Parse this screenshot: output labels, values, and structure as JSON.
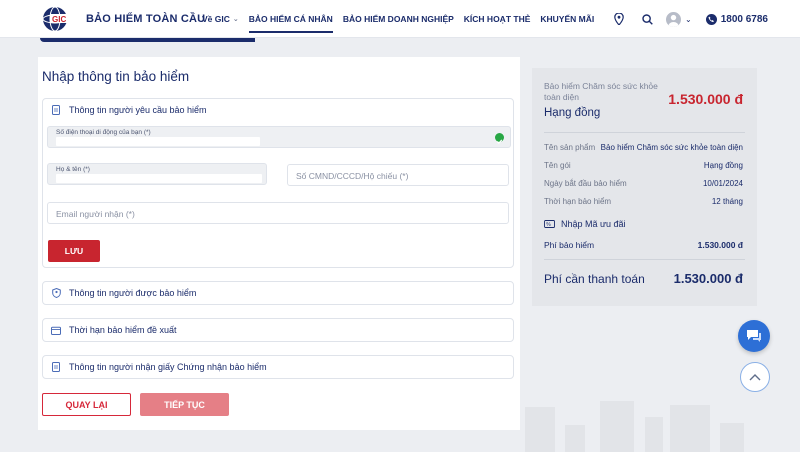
{
  "header": {
    "logo_text": "BẢO HIỂM TOÀN CẦU",
    "logo_abbr": "GIC",
    "nav": [
      {
        "label": "Về GIC",
        "dropdown": true
      },
      {
        "label": "BẢO HIỂM CÁ NHÂN",
        "active": true
      },
      {
        "label": "BẢO HIỂM DOANH NGHIỆP"
      },
      {
        "label": "KÍCH HOẠT THẺ"
      },
      {
        "label": "KHUYẾN MÃI"
      }
    ],
    "phone": "1800 6786",
    "icons": [
      "location-icon",
      "search-icon",
      "avatar",
      "chevron-down-icon",
      "phone-icon"
    ]
  },
  "form": {
    "title": "Nhập thông tin bảo hiểm",
    "requester": {
      "heading": "Thông tin người yêu cầu bảo hiểm",
      "phone_label": "Số điện thoại di động của bạn (*)",
      "name_label": "Họ & tên (*)",
      "id_placeholder": "Số CMND/CCCD/Hộ chiếu (*)",
      "email_placeholder": "Email người nhận (*)",
      "save_label": "LƯU"
    },
    "sections": [
      {
        "label": "Thông tin người được bảo hiểm",
        "icon": "shield-person-icon"
      },
      {
        "label": "Thời hạn bảo hiểm đề xuất",
        "icon": "calendar-icon"
      },
      {
        "label": "Thông tin người nhận giấy Chứng nhận bảo hiểm",
        "icon": "document-icon"
      }
    ],
    "back_label": "QUAY LẠI",
    "next_label": "TIẾP TỤC"
  },
  "summary": {
    "product_name": "Bảo hiểm Chăm sóc sức khỏe toàn diện",
    "plan": "Hạng đồng",
    "price": "1.530.000 đ",
    "rows": [
      {
        "label": "Tên sản phẩm",
        "value": "Bảo hiểm Chăm sóc sức khỏe toàn diện"
      },
      {
        "label": "Tên gói",
        "value": "Hạng đồng"
      },
      {
        "label": "Ngày bắt đầu bảo hiểm",
        "value": "10/01/2024"
      },
      {
        "label": "Thời hạn bảo hiểm",
        "value": "12 tháng"
      }
    ],
    "promo_label": "Nhập Mã ưu đãi",
    "fee_label": "Phí bảo hiểm",
    "fee_value": "1.530.000 đ",
    "total_label": "Phí cần thanh toán",
    "total_value": "1.530.000 đ"
  },
  "colors": {
    "brand_navy": "#1b2c6b",
    "accent_red": "#c8252f",
    "next_disabled": "#e57f86",
    "success_green": "#28a745",
    "chat_blue": "#2d6fd6"
  }
}
